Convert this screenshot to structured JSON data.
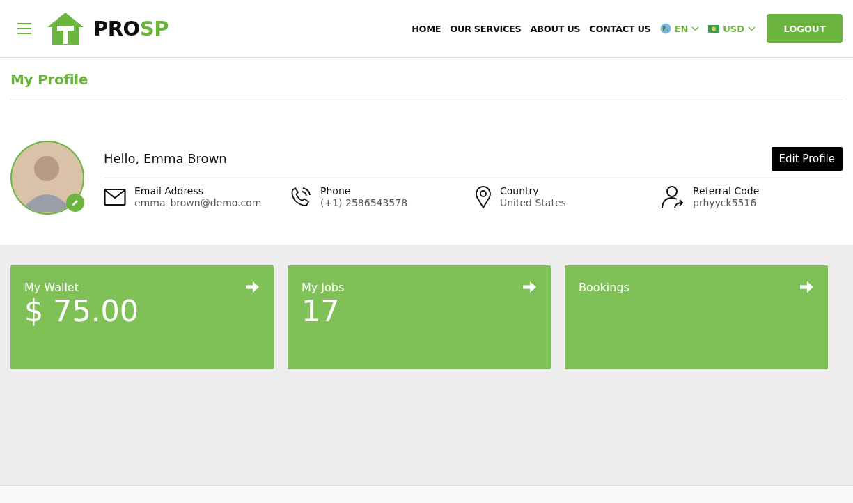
{
  "header": {
    "brand": {
      "dark": "PRO",
      "accent": "SP"
    },
    "nav": [
      "HOME",
      "OUR SERVICES",
      "ABOUT US",
      "CONTACT US"
    ],
    "language": "EN",
    "currency": "USD",
    "logout": "LOGOUT"
  },
  "page_title": "My Profile",
  "profile": {
    "greeting": "Hello, Emma Brown",
    "edit_button": "Edit Profile",
    "details": [
      {
        "kind": "email",
        "label": "Email Address",
        "value": "emma_brown@demo.com"
      },
      {
        "kind": "phone",
        "label": "Phone",
        "value": "(+1) 2586543578"
      },
      {
        "kind": "location",
        "label": "Country",
        "value": "United States"
      },
      {
        "kind": "referral",
        "label": "Referral Code",
        "value": "prhyyck5516"
      }
    ]
  },
  "cards": [
    {
      "label": "My Wallet",
      "value": "$ 75.00"
    },
    {
      "label": "My Jobs",
      "value": "17"
    },
    {
      "label": "Bookings"
    }
  ]
}
